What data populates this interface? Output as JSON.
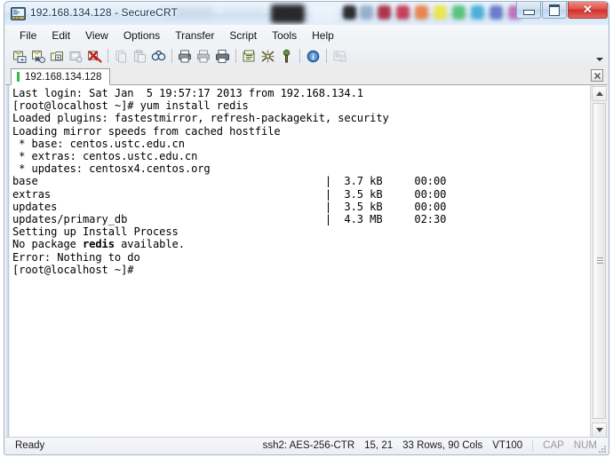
{
  "window": {
    "title": "192.168.134.128 - SecureCRT",
    "icon": "securecrt-app-icon",
    "buttons": {
      "minimize": "minimize",
      "maximize": "maximize",
      "close": "✕"
    }
  },
  "menubar": {
    "items": [
      {
        "label": "File"
      },
      {
        "label": "Edit"
      },
      {
        "label": "View"
      },
      {
        "label": "Options"
      },
      {
        "label": "Transfer"
      },
      {
        "label": "Script"
      },
      {
        "label": "Tools"
      },
      {
        "label": "Help"
      }
    ]
  },
  "toolbar": {
    "buttons": [
      {
        "name": "connect-icon"
      },
      {
        "name": "quick-connect-icon"
      },
      {
        "name": "connect-in-tab-icon"
      },
      {
        "name": "connect-sftp-tab-icon"
      },
      {
        "name": "disconnect-icon"
      },
      {
        "name": "separator-1"
      },
      {
        "name": "copy-icon"
      },
      {
        "name": "paste-icon"
      },
      {
        "name": "find-icon"
      },
      {
        "name": "separator-2"
      },
      {
        "name": "print-icon"
      },
      {
        "name": "log-session-icon"
      },
      {
        "name": "print-selection-icon"
      },
      {
        "name": "separator-3"
      },
      {
        "name": "session-options-icon"
      },
      {
        "name": "global-options-icon"
      },
      {
        "name": "key-options-icon"
      },
      {
        "name": "separator-4"
      },
      {
        "name": "help-icon"
      },
      {
        "name": "separator-5"
      },
      {
        "name": "session-manager-icon"
      }
    ],
    "overflow": "toolbar-overflow-chevron"
  },
  "tabs": {
    "items": [
      {
        "label": "192.168.134.128",
        "connected": true
      }
    ],
    "close_label": "✕"
  },
  "terminal": {
    "lines": [
      {
        "text": "Last login: Sat Jan  5 19:57:17 2013 from 192.168.134.1"
      },
      {
        "text": "[root@localhost ~]# yum install redis"
      },
      {
        "text": "Loaded plugins: fastestmirror, refresh-packagekit, security"
      },
      {
        "text": "Loading mirror speeds from cached hostfile"
      },
      {
        "text": " * base: centos.ustc.edu.cn"
      },
      {
        "text": " * extras: centos.ustc.edu.cn"
      },
      {
        "text": " * updates: centosx4.centos.org"
      },
      {
        "text": "base                                             |  3.7 kB     00:00"
      },
      {
        "text": "extras                                           |  3.5 kB     00:00"
      },
      {
        "text": "updates                                          |  3.5 kB     00:00"
      },
      {
        "text": "updates/primary_db                               |  4.3 MB     02:30"
      },
      {
        "text": "Setting up Install Process"
      },
      {
        "text": "No package ",
        "bold": "redis",
        "after": " available."
      },
      {
        "text": "Error: Nothing to do"
      },
      {
        "text": "[root@localhost ~]#"
      }
    ]
  },
  "statusbar": {
    "ready": "Ready",
    "protocol": "ssh2: AES-256-CTR",
    "cursor_position": "15, 21",
    "dimensions": "33 Rows, 90 Cols",
    "emulation": "VT100",
    "cap": "CAP",
    "num": "NUM"
  },
  "scrollbar": {
    "up_arrow": "scroll-up",
    "down_arrow": "scroll-down"
  },
  "glass_swatches": [
    "#141414",
    "#8fa9c4",
    "#a51f35",
    "#c42a44",
    "#e8793a",
    "#ece53c",
    "#4bbd6d",
    "#3aa8d6",
    "#5a6fc0",
    "#b濃",
    "#b767b4"
  ],
  "colors": {
    "accent": "#2f6fa8",
    "tab_connected": "#35b94b",
    "close_button": "#cf3028",
    "terminal_bg": "#ffffff",
    "terminal_fg": "#000000"
  }
}
